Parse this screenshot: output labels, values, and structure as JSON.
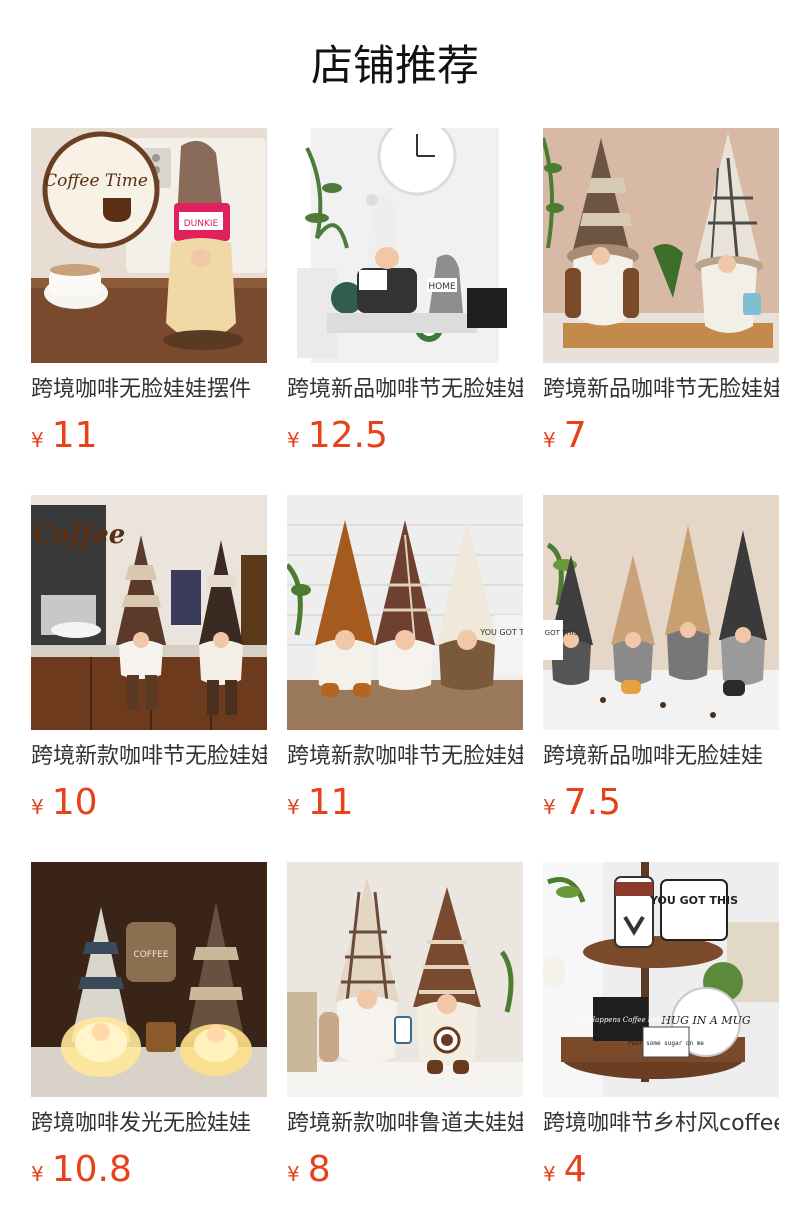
{
  "title": "店铺推荐",
  "currency_symbol": "¥",
  "accent_color": "#e8411a",
  "products": [
    {
      "name": "跨境咖啡无脸娃娃摆件",
      "price": "11",
      "image": "coffee-bottle-gnome-image",
      "badge": "Coffee Time",
      "tag": "DUNKIE"
    },
    {
      "name": "跨境新品咖啡节无脸娃娃",
      "price": "12.5",
      "image": "two-gnomes-clock-image",
      "tag": "HOME"
    },
    {
      "name": "跨境新品咖啡节无脸娃娃",
      "price": "7",
      "image": "striped-plaid-gnomes-image"
    },
    {
      "name": "跨境新款咖啡节无脸娃娃",
      "price": "10",
      "image": "coffee-machine-gnomes-image",
      "badge": "Coffee"
    },
    {
      "name": "跨境新款咖啡节无脸娃娃",
      "price": "11",
      "image": "three-gnomes-brick-image",
      "tag": "YOU GOT THIS"
    },
    {
      "name": "跨境新品咖啡无脸娃娃",
      "price": "7.5",
      "image": "four-gnomes-sitting-image",
      "tag": "YOU GOT THIS"
    },
    {
      "name": "跨境咖啡发光无脸娃娃",
      "price": "10.8",
      "image": "glowing-gnomes-image",
      "tag": "COFFEE"
    },
    {
      "name": "跨境新款咖啡鲁道夫娃娃",
      "price": "8",
      "image": "plaid-striped-gnome-pair-image"
    },
    {
      "name": "跨境咖啡节乡村风coffee",
      "price": "4",
      "image": "tiered-tray-decor-image",
      "tag": "YOU GOT THIS",
      "tag2": "HUG IN A MUG",
      "tag3": "Life Happens Coffee helps",
      "tag4": "Pour some sugar on me"
    }
  ]
}
